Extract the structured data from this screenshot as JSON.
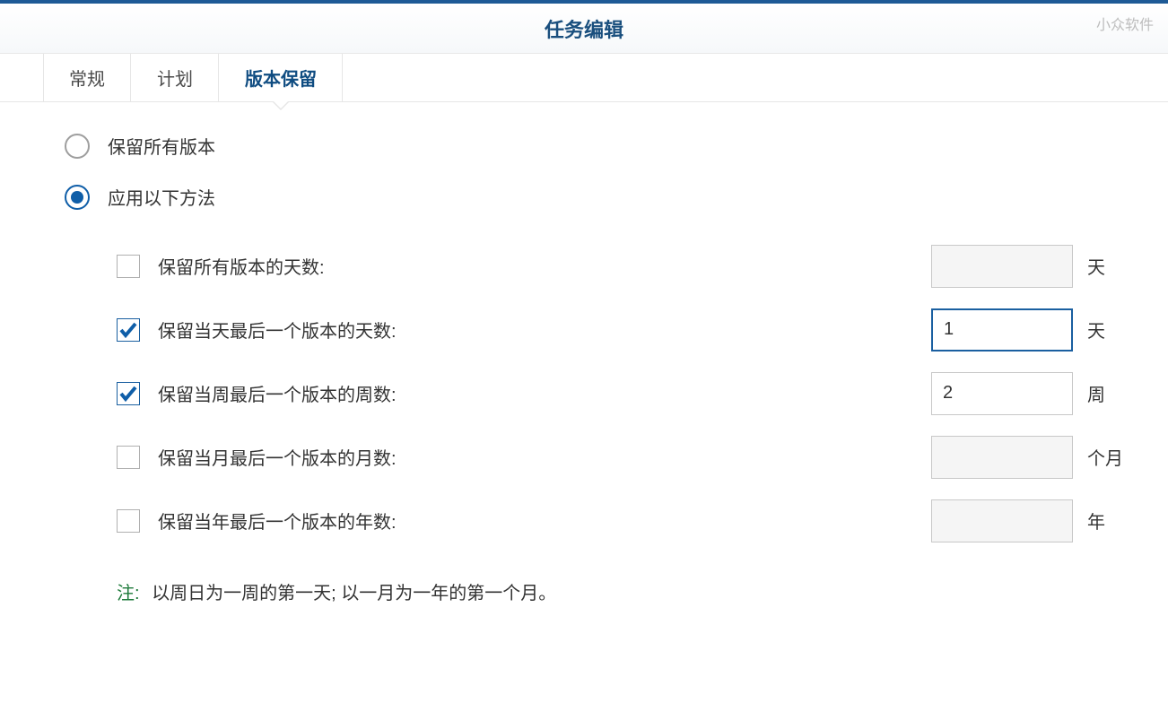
{
  "watermark": "小众软件",
  "header": {
    "title": "任务编辑"
  },
  "tabs": [
    {
      "label": "常规",
      "active": false
    },
    {
      "label": "计划",
      "active": false
    },
    {
      "label": "版本保留",
      "active": true
    }
  ],
  "radios": {
    "keep_all": {
      "label": "保留所有版本",
      "selected": false
    },
    "apply_method": {
      "label": "应用以下方法",
      "selected": true
    }
  },
  "options": {
    "all_days": {
      "checked": false,
      "label": "保留所有版本的天数:",
      "value": "",
      "unit": "天",
      "disabled": true,
      "focused": false
    },
    "day_last": {
      "checked": true,
      "label": "保留当天最后一个版本的天数:",
      "value": "1",
      "unit": "天",
      "disabled": false,
      "focused": true
    },
    "week_last": {
      "checked": true,
      "label": "保留当周最后一个版本的周数:",
      "value": "2",
      "unit": "周",
      "disabled": false,
      "focused": false
    },
    "month_last": {
      "checked": false,
      "label": "保留当月最后一个版本的月数:",
      "value": "",
      "unit": "个月",
      "disabled": true,
      "focused": false
    },
    "year_last": {
      "checked": false,
      "label": "保留当年最后一个版本的年数:",
      "value": "",
      "unit": "年",
      "disabled": true,
      "focused": false
    }
  },
  "note": {
    "label": "注:",
    "text": "以周日为一周的第一天; 以一月为一年的第一个月。"
  }
}
